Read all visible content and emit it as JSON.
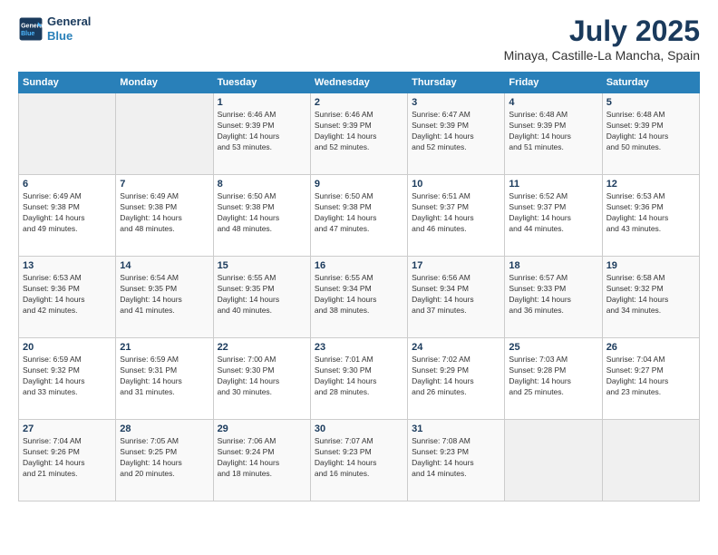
{
  "logo": {
    "line1": "General",
    "line2": "Blue"
  },
  "title": "July 2025",
  "subtitle": "Minaya, Castille-La Mancha, Spain",
  "days_of_week": [
    "Sunday",
    "Monday",
    "Tuesday",
    "Wednesday",
    "Thursday",
    "Friday",
    "Saturday"
  ],
  "weeks": [
    [
      {
        "num": "",
        "info": ""
      },
      {
        "num": "",
        "info": ""
      },
      {
        "num": "1",
        "info": "Sunrise: 6:46 AM\nSunset: 9:39 PM\nDaylight: 14 hours\nand 53 minutes."
      },
      {
        "num": "2",
        "info": "Sunrise: 6:46 AM\nSunset: 9:39 PM\nDaylight: 14 hours\nand 52 minutes."
      },
      {
        "num": "3",
        "info": "Sunrise: 6:47 AM\nSunset: 9:39 PM\nDaylight: 14 hours\nand 52 minutes."
      },
      {
        "num": "4",
        "info": "Sunrise: 6:48 AM\nSunset: 9:39 PM\nDaylight: 14 hours\nand 51 minutes."
      },
      {
        "num": "5",
        "info": "Sunrise: 6:48 AM\nSunset: 9:39 PM\nDaylight: 14 hours\nand 50 minutes."
      }
    ],
    [
      {
        "num": "6",
        "info": "Sunrise: 6:49 AM\nSunset: 9:38 PM\nDaylight: 14 hours\nand 49 minutes."
      },
      {
        "num": "7",
        "info": "Sunrise: 6:49 AM\nSunset: 9:38 PM\nDaylight: 14 hours\nand 48 minutes."
      },
      {
        "num": "8",
        "info": "Sunrise: 6:50 AM\nSunset: 9:38 PM\nDaylight: 14 hours\nand 48 minutes."
      },
      {
        "num": "9",
        "info": "Sunrise: 6:50 AM\nSunset: 9:38 PM\nDaylight: 14 hours\nand 47 minutes."
      },
      {
        "num": "10",
        "info": "Sunrise: 6:51 AM\nSunset: 9:37 PM\nDaylight: 14 hours\nand 46 minutes."
      },
      {
        "num": "11",
        "info": "Sunrise: 6:52 AM\nSunset: 9:37 PM\nDaylight: 14 hours\nand 44 minutes."
      },
      {
        "num": "12",
        "info": "Sunrise: 6:53 AM\nSunset: 9:36 PM\nDaylight: 14 hours\nand 43 minutes."
      }
    ],
    [
      {
        "num": "13",
        "info": "Sunrise: 6:53 AM\nSunset: 9:36 PM\nDaylight: 14 hours\nand 42 minutes."
      },
      {
        "num": "14",
        "info": "Sunrise: 6:54 AM\nSunset: 9:35 PM\nDaylight: 14 hours\nand 41 minutes."
      },
      {
        "num": "15",
        "info": "Sunrise: 6:55 AM\nSunset: 9:35 PM\nDaylight: 14 hours\nand 40 minutes."
      },
      {
        "num": "16",
        "info": "Sunrise: 6:55 AM\nSunset: 9:34 PM\nDaylight: 14 hours\nand 38 minutes."
      },
      {
        "num": "17",
        "info": "Sunrise: 6:56 AM\nSunset: 9:34 PM\nDaylight: 14 hours\nand 37 minutes."
      },
      {
        "num": "18",
        "info": "Sunrise: 6:57 AM\nSunset: 9:33 PM\nDaylight: 14 hours\nand 36 minutes."
      },
      {
        "num": "19",
        "info": "Sunrise: 6:58 AM\nSunset: 9:32 PM\nDaylight: 14 hours\nand 34 minutes."
      }
    ],
    [
      {
        "num": "20",
        "info": "Sunrise: 6:59 AM\nSunset: 9:32 PM\nDaylight: 14 hours\nand 33 minutes."
      },
      {
        "num": "21",
        "info": "Sunrise: 6:59 AM\nSunset: 9:31 PM\nDaylight: 14 hours\nand 31 minutes."
      },
      {
        "num": "22",
        "info": "Sunrise: 7:00 AM\nSunset: 9:30 PM\nDaylight: 14 hours\nand 30 minutes."
      },
      {
        "num": "23",
        "info": "Sunrise: 7:01 AM\nSunset: 9:30 PM\nDaylight: 14 hours\nand 28 minutes."
      },
      {
        "num": "24",
        "info": "Sunrise: 7:02 AM\nSunset: 9:29 PM\nDaylight: 14 hours\nand 26 minutes."
      },
      {
        "num": "25",
        "info": "Sunrise: 7:03 AM\nSunset: 9:28 PM\nDaylight: 14 hours\nand 25 minutes."
      },
      {
        "num": "26",
        "info": "Sunrise: 7:04 AM\nSunset: 9:27 PM\nDaylight: 14 hours\nand 23 minutes."
      }
    ],
    [
      {
        "num": "27",
        "info": "Sunrise: 7:04 AM\nSunset: 9:26 PM\nDaylight: 14 hours\nand 21 minutes."
      },
      {
        "num": "28",
        "info": "Sunrise: 7:05 AM\nSunset: 9:25 PM\nDaylight: 14 hours\nand 20 minutes."
      },
      {
        "num": "29",
        "info": "Sunrise: 7:06 AM\nSunset: 9:24 PM\nDaylight: 14 hours\nand 18 minutes."
      },
      {
        "num": "30",
        "info": "Sunrise: 7:07 AM\nSunset: 9:23 PM\nDaylight: 14 hours\nand 16 minutes."
      },
      {
        "num": "31",
        "info": "Sunrise: 7:08 AM\nSunset: 9:23 PM\nDaylight: 14 hours\nand 14 minutes."
      },
      {
        "num": "",
        "info": ""
      },
      {
        "num": "",
        "info": ""
      }
    ]
  ]
}
